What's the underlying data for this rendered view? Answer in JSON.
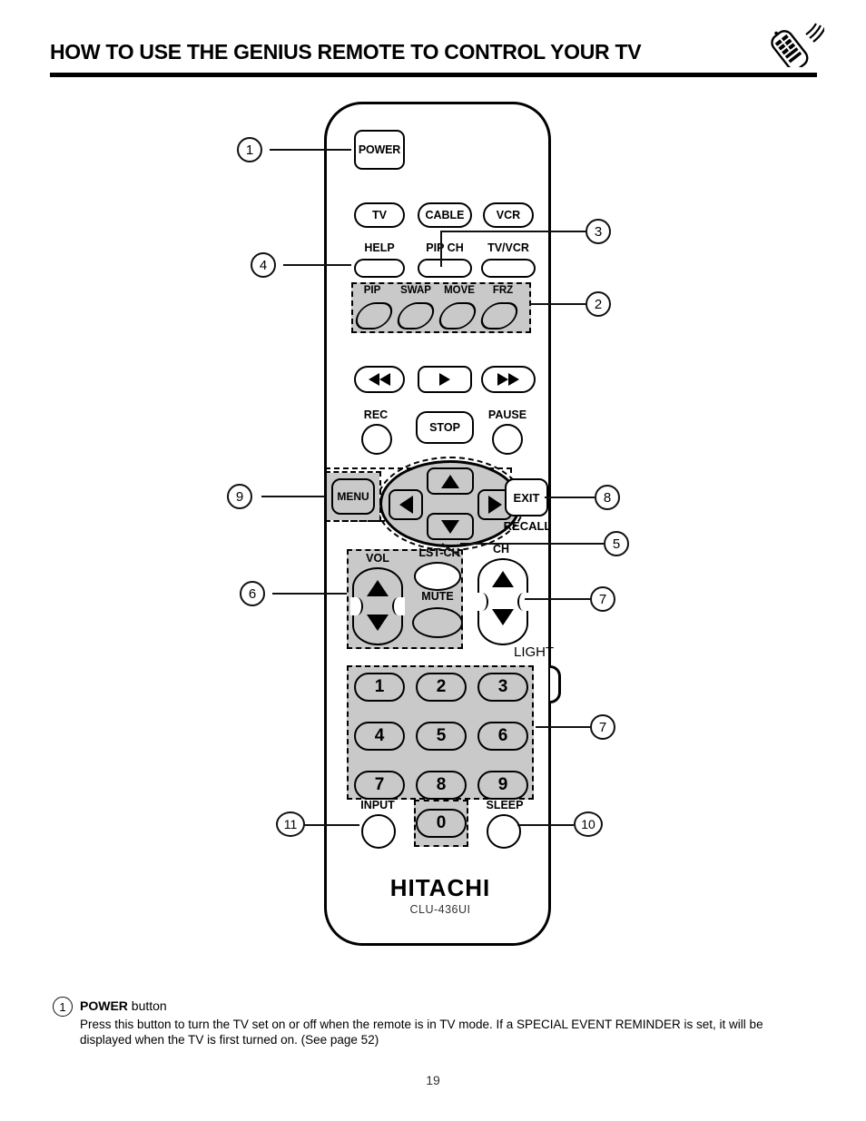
{
  "header": {
    "title": "HOW TO USE THE GENIUS REMOTE TO CONTROL YOUR TV",
    "icon": "remote-control-signal-icon"
  },
  "remote": {
    "brand": "HITACHI",
    "model": "CLU-436UI",
    "power_button": "POWER",
    "mode_buttons": [
      {
        "label": "TV"
      },
      {
        "label": "CABLE"
      },
      {
        "label": "VCR"
      }
    ],
    "function_buttons": [
      {
        "label": "HELP"
      },
      {
        "label": "PIP CH"
      },
      {
        "label": "TV/VCR"
      }
    ],
    "pip_group": [
      {
        "label": "PIP"
      },
      {
        "label": "SWAP"
      },
      {
        "label": "MOVE"
      },
      {
        "label": "FRZ"
      }
    ],
    "transport_buttons": [
      {
        "icon": "rewind-icon"
      },
      {
        "icon": "play-icon"
      },
      {
        "icon": "fast-forward-icon"
      }
    ],
    "vcr_buttons": [
      {
        "label": "REC"
      },
      {
        "label": "STOP"
      },
      {
        "label": "PAUSE"
      }
    ],
    "menu_button": "MENU",
    "exit_button": "EXIT",
    "recall_label": "RECALL",
    "nav_pad": {
      "up": "up-arrow-icon",
      "down": "down-arrow-icon",
      "left": "left-arrow-icon",
      "right": "right-arrow-icon"
    },
    "volume_label": "VOL",
    "channel_label": "CH",
    "mute_label": "MUTE",
    "last_channel_label": "LST-CH",
    "light_label": "LIGHT",
    "keypad": [
      "1",
      "2",
      "3",
      "4",
      "5",
      "6",
      "7",
      "8",
      "9"
    ],
    "zero_key": "0",
    "input_label": "INPUT",
    "sleep_label": "SLEEP"
  },
  "callouts": [
    {
      "id": "1",
      "label": "1"
    },
    {
      "id": "2",
      "label": "2"
    },
    {
      "id": "3",
      "label": "3"
    },
    {
      "id": "4",
      "label": "4"
    },
    {
      "id": "5",
      "label": "5"
    },
    {
      "id": "6",
      "label": "6"
    },
    {
      "id": "7a",
      "label": "7"
    },
    {
      "id": "7b",
      "label": "7"
    },
    {
      "id": "8",
      "label": "8"
    },
    {
      "id": "9",
      "label": "9"
    },
    {
      "id": "10",
      "label": "10"
    },
    {
      "id": "11",
      "label": "11"
    }
  ],
  "caption": {
    "number": "1",
    "heading_bold": "POWER",
    "heading_rest": " button",
    "body": "Press this button to turn the TV set on or off when the remote is in TV mode. If a SPECIAL EVENT REMINDER is set, it will be displayed when the TV is first turned on. (See page 52)"
  },
  "footer": {
    "page_number": "19"
  }
}
